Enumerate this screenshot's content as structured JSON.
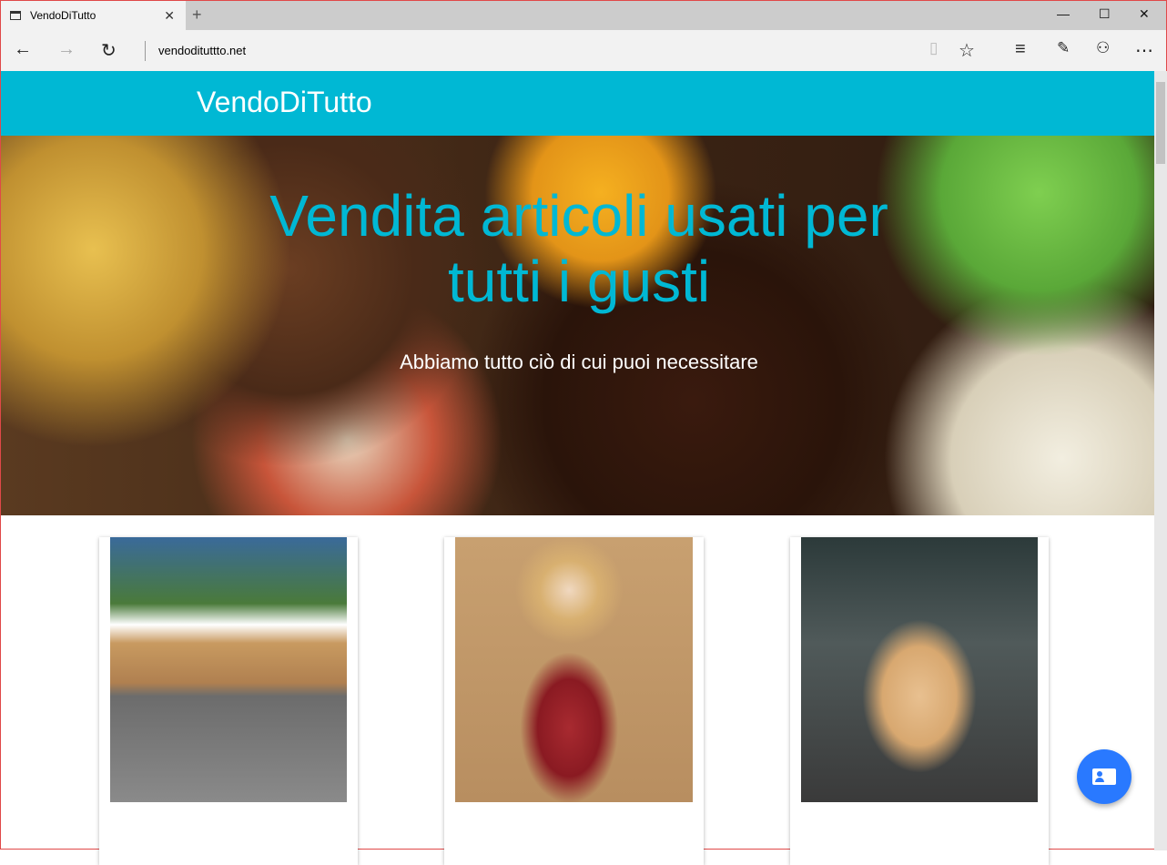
{
  "browser": {
    "tab_title": "VendoDiTutto",
    "url": "vendodituttto.net"
  },
  "site": {
    "brand": "VendoDiTutto",
    "hero_title": "Vendita articoli usati per tutti i gusti",
    "hero_subtitle": "Abbiamo tutto ciò di cui puoi necessitare"
  },
  "products": [
    {
      "image": "wooden-desk"
    },
    {
      "image": "porcelain-doll"
    },
    {
      "image": "wooden-nightstand"
    }
  ],
  "colors": {
    "primary": "#00b8d4",
    "fab": "#2979ff"
  }
}
